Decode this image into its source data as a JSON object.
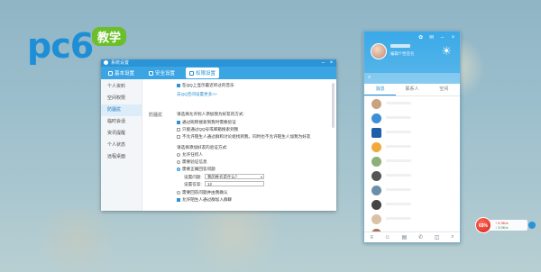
{
  "logo": {
    "text": "pc6",
    "badge": "教学"
  },
  "settings_window": {
    "title": "系统设置",
    "tabs": [
      {
        "label": "基本设置",
        "active": false
      },
      {
        "label": "安全设置",
        "active": false
      },
      {
        "label": "权限设置",
        "active": true
      }
    ],
    "nav": [
      "个人资料",
      "空间权限",
      "防骚扰",
      "临时会话",
      "资讯提醒",
      "个人状态",
      "远程桌面"
    ],
    "nav_active_index": 2,
    "top_options": [
      {
        "label": "在QQ上显示最近听过的音乐",
        "checked": true
      }
    ],
    "qq_link": "去QQ空间设置更多>>",
    "section_label": "防骚扰",
    "verify_heading": "请选择允许别人添加我为好友的方式:",
    "verify_options": [
      {
        "label": "通过昵称搜索到我时需要验证",
        "checked": true
      },
      {
        "label": "只能通过QQ号或邮箱搜索到我",
        "checked": false
      },
      {
        "label": "不允许陌生人通过群和讨论组找到我，同时也不允许陌生人加我为好友",
        "checked": false
      }
    ],
    "friend_method_heading": "请选择添加好友的验证方式:",
    "friend_methods": [
      {
        "label": "允许任何人",
        "selected": false
      },
      {
        "label": "需要验证信息",
        "selected": false
      },
      {
        "label": "需要正确回答问题",
        "selected": true
      }
    ],
    "question_label": "设置问题:",
    "question_value": "我的姓名是什么？",
    "answer_label": "设置答案:",
    "answer_value": "12",
    "extra_options": [
      {
        "label": "需要回答问题并由我确认",
        "type": "radio",
        "selected": false
      },
      {
        "label": "允许陌生人通过群加入群聊",
        "type": "checkbox",
        "checked": true
      }
    ],
    "accent_color": "#2a94d6"
  },
  "qq_panel": {
    "signature": "编辑个性签名",
    "tabs": [
      {
        "label": "消息",
        "active": true
      },
      {
        "label": "联系人",
        "active": false
      },
      {
        "label": "空间",
        "active": false
      }
    ],
    "contacts_count": 11,
    "header_color": "#3aa9e8"
  },
  "net_widget": {
    "percent": "65%",
    "upload": "0.3K/s",
    "download": "3.0K/s"
  }
}
